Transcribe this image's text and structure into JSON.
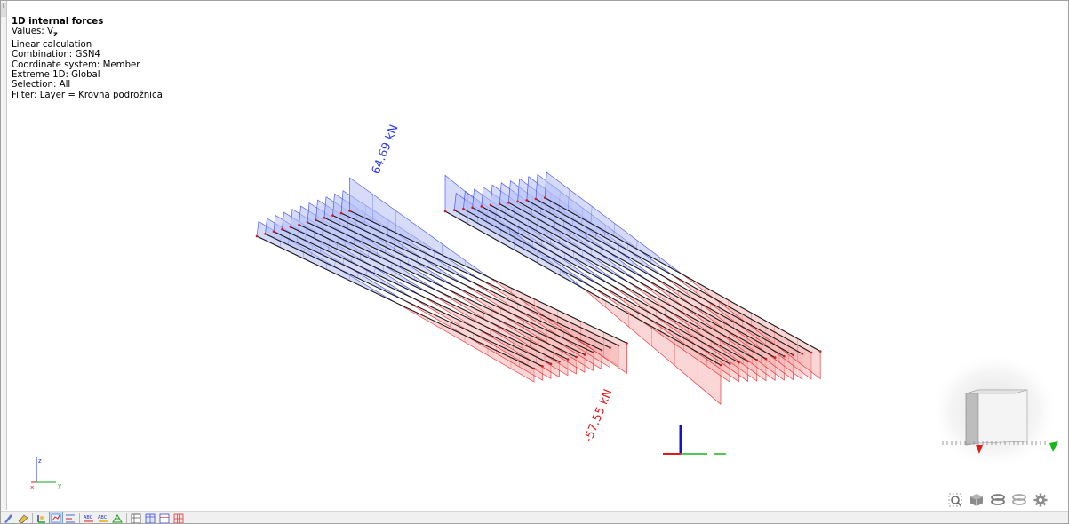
{
  "info": {
    "title": "1D internal forces",
    "values_line": "Values: V",
    "values_sub": "z",
    "calc": "Linear calculation",
    "combination": "Combination: GSN4",
    "coord_system": "Coordinate system: Member",
    "extreme": "Extreme 1D: Global",
    "selection": "Selection: All",
    "filter": "Filter: Layer = Krovna podrožnica"
  },
  "labels": {
    "max": "64.69 kN",
    "min": "-57.55 kN"
  },
  "axes": {
    "z": "z",
    "x": "x",
    "y": "y"
  },
  "colors": {
    "positive_fill": "#b4bdf6",
    "positive_stroke": "#2a3cf0",
    "negative_fill": "#f6b4b4",
    "negative_stroke": "#e01a1a",
    "member": "#1a1a1a"
  },
  "toolbar": {
    "icons": [
      "pencil-icon",
      "eraser-icon",
      "axis-system-icon",
      "diagram-icon",
      "list-icon",
      "abc-labels-icon",
      "abc-values-icon",
      "mesh-icon",
      "grid-table-icon",
      "table-icon",
      "table-grid-icon",
      "table-red-icon"
    ],
    "active_index": 3
  },
  "view_controls": [
    "zoom-icon",
    "view-cube-icon",
    "layers-icon",
    "layers-alt-icon",
    "settings-icon"
  ]
}
